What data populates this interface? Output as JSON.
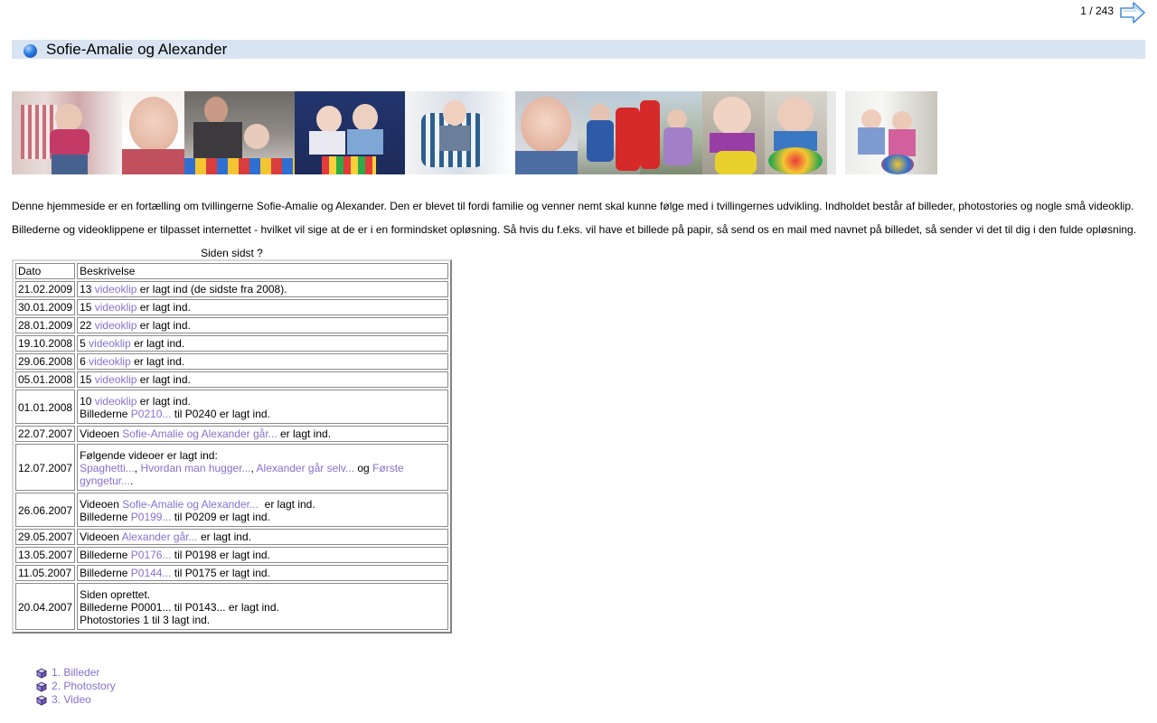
{
  "pager": {
    "text": "1 / 243"
  },
  "title": "Sofie-Amalie og Alexander",
  "colors": {
    "title_bg": "#d9e4f2",
    "link": "#8870d0"
  },
  "icons": {
    "next": "arrow-right-icon",
    "title": "globe-icon",
    "nav": "cube-icon"
  },
  "intro": {
    "p1": "Denne hjemmeside er en fortælling om tvillingerne Sofie-Amalie og Alexander. Den er blevet til fordi familie og venner nemt skal kunne følge med i tvillingernes udvikling. Indholdet består af billeder, photostories og nogle små videoklip.",
    "p2": "Billederne og videoklippene er tilpasset internettet - hvilket vil sige at de er i en formindsket opløsning. Så hvis du f.eks. vil have et billede på papir, så send os en mail med navnet på billedet, så sender vi det til dig i den fulde opløsning."
  },
  "updates": {
    "title": "Siden sidst ?",
    "headers": {
      "date": "Dato",
      "desc": "Beskrivelse"
    },
    "rows": {
      "r1": {
        "date": "21.02.2009",
        "n": "13 ",
        "link": "videoklip",
        "rest": " er lagt ind (de sidste fra 2008)."
      },
      "r2": {
        "date": "30.01.2009",
        "n": "15 ",
        "link": "videoklip",
        "rest": " er lagt ind."
      },
      "r3": {
        "date": "28.01.2009",
        "n": "22 ",
        "link": "videoklip",
        "rest": " er lagt ind."
      },
      "r4": {
        "date": "19.10.2008",
        "n": "5 ",
        "link": "videoklip",
        "rest": " er lagt ind."
      },
      "r5": {
        "date": "29.06.2008",
        "n": "6 ",
        "link": "videoklip",
        "rest": " er lagt ind."
      },
      "r6": {
        "date": "05.01.2008",
        "n": "15 ",
        "link": "videoklip",
        "rest": " er lagt ind."
      },
      "r7": {
        "date": "01.01.2008",
        "n": "10 ",
        "link": "videoklip",
        "rest": " er lagt ind.",
        "b_pre": "Billederne ",
        "b_link": "P0210...",
        "b_rest": " til P0240 er lagt ind."
      },
      "r8": {
        "date": "22.07.2007",
        "pre": "Videoen ",
        "link": "Sofie-Amalie og Alexander går...",
        "rest": " er lagt ind."
      },
      "r9": {
        "date": "12.07.2007",
        "line1": "Følgende videoer er lagt ind:",
        "l1": "Spaghetti...",
        "s1": ", ",
        "l2": "Hvordan man hugger...",
        "s2": ", ",
        "l3": "Alexander går selv...",
        "s3": " og ",
        "l4": "Første gyngetur...",
        "s4": "."
      },
      "r10": {
        "date": "26.06.2007",
        "pre": "Videoen ",
        "link": "Sofie-Amalie og Alexander...",
        "rest": "  er lagt ind.",
        "b_pre": "Billederne ",
        "b_link": "P0199...",
        "b_rest": " til P0209 er lagt ind."
      },
      "r11": {
        "date": "29.05.2007",
        "pre": "Videoen ",
        "link": "Alexander går...",
        "rest": " er lagt ind."
      },
      "r12": {
        "date": "13.05.2007",
        "pre": "Billederne ",
        "link": "P0176...",
        "rest": " til P0198 er lagt ind."
      },
      "r13": {
        "date": "11.05.2007",
        "pre": "Billederne ",
        "link": "P0144...",
        "rest": " til P0175 er lagt ind."
      },
      "r14": {
        "date": "20.04.2007",
        "line1": "Siden oprettet.",
        "line2": "Billederne P0001... til P0143... er lagt ind.",
        "line3": "Photostories 1 til 3 lagt ind."
      }
    }
  },
  "nav": {
    "items": [
      {
        "label": "1. Billeder"
      },
      {
        "label": "2. Photostory"
      },
      {
        "label": "3. Video"
      }
    ]
  }
}
